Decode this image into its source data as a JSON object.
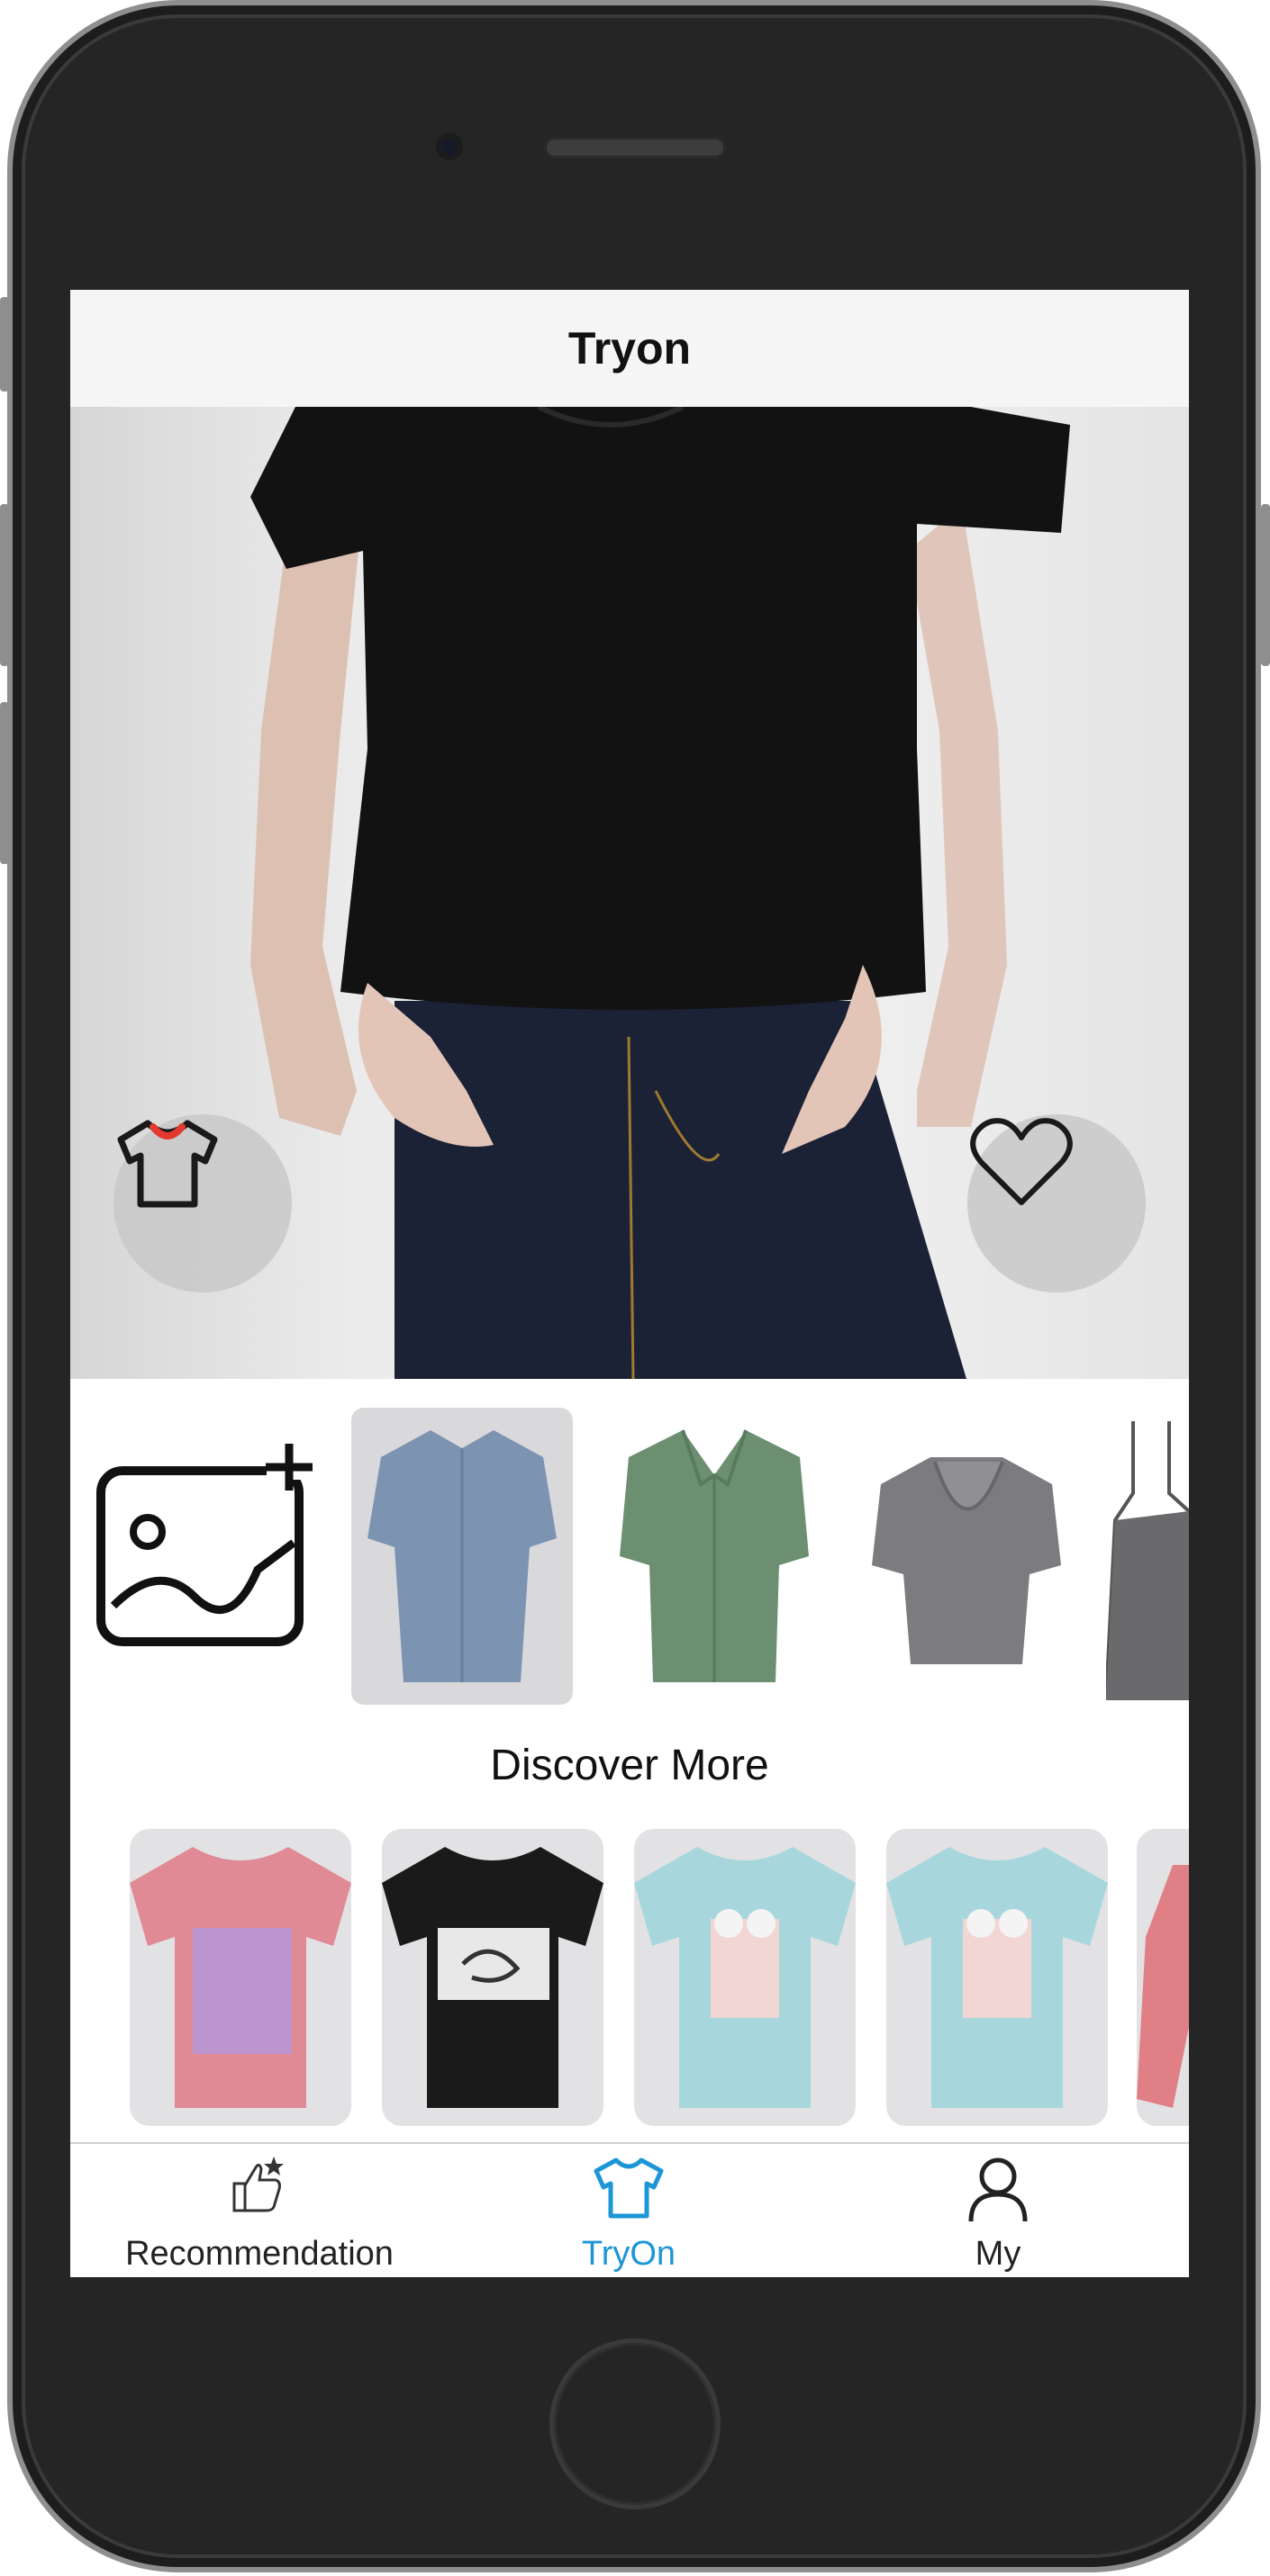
{
  "nav": {
    "title": "Tryon"
  },
  "hero": {
    "left_button_icon": "tshirt-icon",
    "right_button_icon": "heart-icon"
  },
  "clothing_strip": {
    "add_photo_icon": "add-photo-icon",
    "items": [
      {
        "name": "blue short-sleeve shirt",
        "color": "#7d93b2",
        "selected": true
      },
      {
        "name": "green short-sleeve shirt",
        "color": "#6b8f70",
        "selected": false
      },
      {
        "name": "grey ruffle top",
        "color": "#7b7b80",
        "selected": false
      },
      {
        "name": "grey camisole",
        "color": "#6a6a6c",
        "selected": false
      }
    ]
  },
  "discover": {
    "title": "Discover More",
    "items": [
      {
        "name": "pink graphic tee",
        "color": "#e08a95"
      },
      {
        "name": "black graphic tee",
        "color": "#1a1a1a"
      },
      {
        "name": "light blue graphic tee",
        "color": "#a7d7dc"
      },
      {
        "name": "light blue graphic tee",
        "color": "#a7d7dc"
      },
      {
        "name": "pink item",
        "color": "#e07f86"
      }
    ]
  },
  "tabs": [
    {
      "label": "Recommendation",
      "icon": "thumbs-up-icon",
      "active": false
    },
    {
      "label": "TryOn",
      "icon": "tshirt-icon",
      "active": true
    },
    {
      "label": "My",
      "icon": "user-icon",
      "active": false
    }
  ],
  "colors": {
    "accent": "#1c96d6",
    "heart_button_bg": "#c8c8c8"
  }
}
